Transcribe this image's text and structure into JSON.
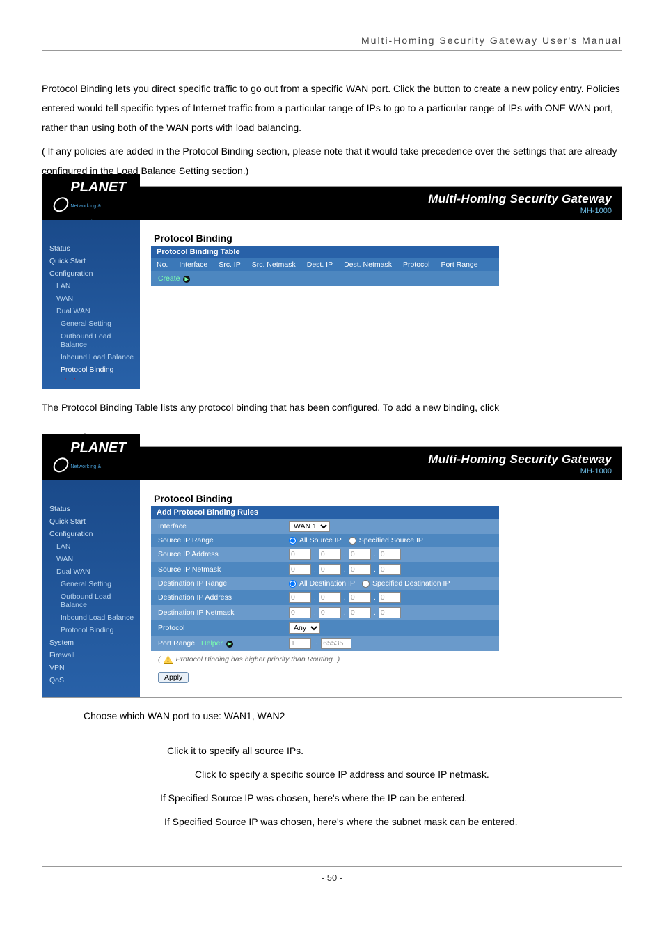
{
  "header": "Multi-Homing  Security  Gateway  User's  Manual",
  "para1": "Protocol Binding lets you direct specific traffic to go out from a specific WAN port. Click the           button to create a new policy entry. Policies entered would tell specific types of Internet traffic from a particular range of IPs to go to a particular range of IPs with ONE WAN port, rather than using both of the WAN ports with load balancing.",
  "para2_prefix": "(",
  "para2": "          If any policies are added in the Protocol Binding section, please note that it would take precedence over the settings that are already configured in the Load Balance Setting section.)",
  "sshot1": {
    "logo": "PLANET",
    "logo_sub": "Networking & Communication",
    "title": "Multi-Homing Security Gateway",
    "model": "MH-1000",
    "sidebar": {
      "status": "Status",
      "quick": "Quick Start",
      "config": "Configuration",
      "lan": "LAN",
      "wan": "WAN",
      "dual": "Dual WAN",
      "gen": "General Setting",
      "out": "Outbound Load Balance",
      "in": "Inbound Load Balance",
      "pb": "Protocol Binding"
    },
    "section": "Protocol Binding",
    "subhead": "Protocol Binding Table",
    "cols": {
      "no": "No.",
      "iface": "Interface",
      "srcip": "Src. IP",
      "srcmask": "Src. Netmask",
      "dstip": "Dest. IP",
      "dstmask": "Dest. Netmask",
      "proto": "Protocol",
      "prange": "Port Range"
    },
    "create": "Create"
  },
  "between": "The Protocol Binding Table lists any protocol binding that has been configured. To add a new binding, click",
  "dot": ".",
  "sshot2": {
    "logo": "PLANET",
    "logo_sub": "Networking & Communication",
    "title": "Multi-Homing Security Gateway",
    "model": "MH-1000",
    "sidebar": {
      "status": "Status",
      "quick": "Quick Start",
      "config": "Configuration",
      "lan": "LAN",
      "wan": "WAN",
      "dual": "Dual WAN",
      "gen": "General Setting",
      "out": "Outbound Load Balance",
      "in": "Inbound Load Balance",
      "pb": "Protocol Binding",
      "system": "System",
      "fw": "Firewall",
      "vpn": "VPN",
      "qos": "QoS"
    },
    "section": "Protocol Binding",
    "subhead": "Add Protocol Binding Rules",
    "rows": {
      "iface": "Interface",
      "iface_val": "WAN 1",
      "srcrange": "Source IP Range",
      "srcrange_opt1": "All Source IP",
      "srcrange_opt2": "Specified Source IP",
      "srcaddr": "Source IP Address",
      "srcmask": "Source IP Netmask",
      "dstrange": "Destination IP Range",
      "dstrange_opt1": "All Destination IP",
      "dstrange_opt2": "Specified Destination IP",
      "dstaddr": "Destination IP Address",
      "dstmask": "Destination IP Netmask",
      "proto": "Protocol",
      "proto_val": "Any",
      "prange": "Port Range",
      "helper": "Helper",
      "pr_from": "1",
      "pr_to": "65535",
      "octet": "0"
    },
    "note": "Protocol Binding has higher priority than Routing.",
    "apply": "Apply"
  },
  "after": {
    "l1": "Choose which WAN port to use: WAN1, WAN2",
    "l2": "Click it to specify all source IPs.",
    "l3": "Click to specify a specific source IP address and source IP netmask.",
    "l4": "If Specified Source IP was chosen, here's where the IP can be entered.",
    "l5": "If Specified Source IP was chosen, here's where the subnet mask can be entered."
  },
  "page_no": "- 50 -"
}
